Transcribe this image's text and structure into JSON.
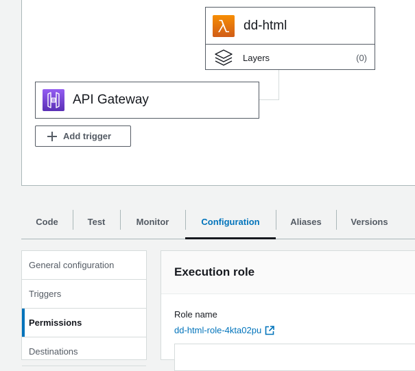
{
  "designer": {
    "function": {
      "name": "dd-html",
      "icon": "lambda-icon",
      "layers_label": "Layers",
      "layers_count": "(0)"
    },
    "trigger": {
      "name": "API Gateway",
      "icon": "api-gateway-icon"
    },
    "add_trigger_label": "Add trigger"
  },
  "tabs": [
    {
      "label": "Code"
    },
    {
      "label": "Test"
    },
    {
      "label": "Monitor"
    },
    {
      "label": "Configuration",
      "active": true
    },
    {
      "label": "Aliases"
    },
    {
      "label": "Versions"
    }
  ],
  "side_nav": {
    "items": [
      {
        "label": "General configuration"
      },
      {
        "label": "Triggers"
      },
      {
        "label": "Permissions",
        "active": true
      },
      {
        "label": "Destinations"
      }
    ]
  },
  "execution_role": {
    "title": "Execution role",
    "role_name_label": "Role name",
    "role_name_value": "dd-html-role-4kta02pu"
  },
  "colors": {
    "accent": "#0073bb",
    "lambda_orange": "#f78e04",
    "api_gateway_purple": "#945df2",
    "active_tab_underline": "#16191f"
  }
}
